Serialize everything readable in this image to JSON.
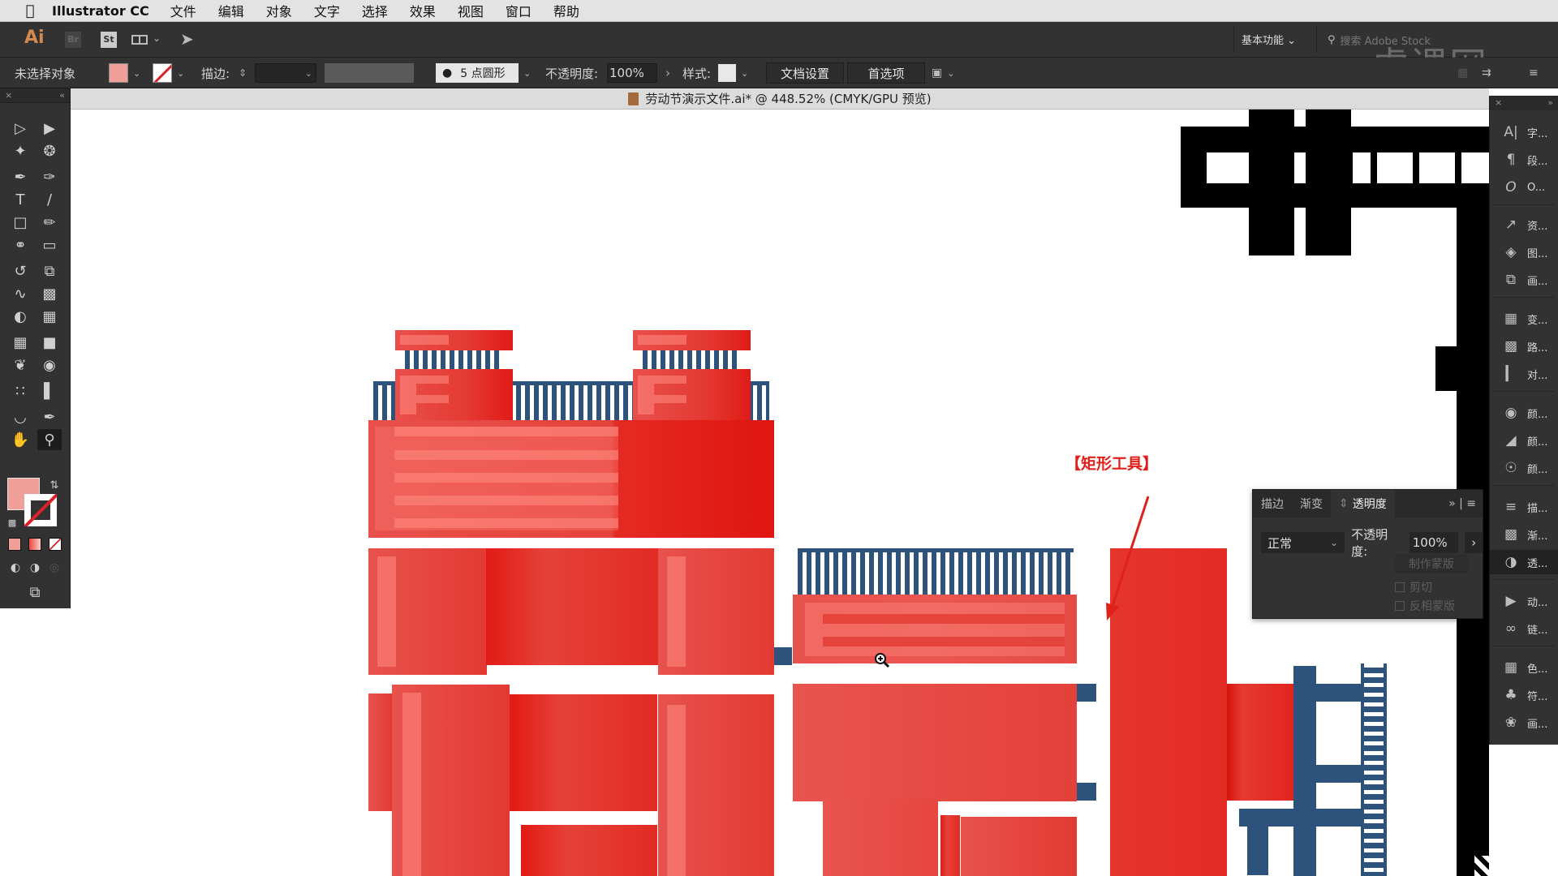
{
  "menubar": {
    "app_name": "Illustrator CC",
    "items": [
      "文件",
      "编辑",
      "对象",
      "文字",
      "选择",
      "效果",
      "视图",
      "窗口",
      "帮助"
    ]
  },
  "appbar": {
    "ai_logo": "Ai",
    "br_logo": "Br",
    "st_logo": "St",
    "workspace_label": "基本功能",
    "search_placeholder": "搜索 Adobe Stock",
    "watermark": "虎课网"
  },
  "controlbar": {
    "selection_status": "未选择对象",
    "fill_color": "#f19f99",
    "stroke_label": "描边:",
    "brush_label": "5 点圆形",
    "opacity_label": "不透明度:",
    "opacity_value": "100%",
    "style_label": "样式:",
    "doc_setup_button": "文档设置",
    "preferences_button": "首选项"
  },
  "document": {
    "title": "劳动节演示文件.ai* @ 448.52% (CMYK/GPU 预览)"
  },
  "toolbox": {
    "fill_color": "#f19f99",
    "stroke_color": "none"
  },
  "canvas": {
    "annotation": "【矩形工具】",
    "colors": {
      "red": "#e43a33",
      "navy": "#2d537c",
      "black": "#000000",
      "annotation": "#e0211b"
    }
  },
  "right_panel": {
    "items": [
      {
        "icon": "character-icon",
        "label": "字..."
      },
      {
        "icon": "paragraph-icon",
        "label": "段..."
      },
      {
        "icon": "opentype-icon",
        "label": "O..."
      },
      {
        "icon": "asset-export-icon",
        "label": "资..."
      },
      {
        "icon": "layers-icon",
        "label": "图..."
      },
      {
        "icon": "artboards-icon",
        "label": "画..."
      },
      {
        "icon": "transform-icon",
        "label": "变..."
      },
      {
        "icon": "pathfinder-icon",
        "label": "路..."
      },
      {
        "icon": "align-icon",
        "label": "对..."
      },
      {
        "icon": "color-icon",
        "label": "颜..."
      },
      {
        "icon": "color-guide-icon",
        "label": "颜..."
      },
      {
        "icon": "color-themes-icon",
        "label": "颜..."
      },
      {
        "icon": "stroke-icon",
        "label": "描..."
      },
      {
        "icon": "gradient-icon",
        "label": "渐..."
      },
      {
        "icon": "transparency-icon",
        "label": "透..."
      },
      {
        "icon": "actions-icon",
        "label": "动..."
      },
      {
        "icon": "links-icon",
        "label": "链..."
      },
      {
        "icon": "swatches-icon",
        "label": "色..."
      },
      {
        "icon": "symbols-icon",
        "label": "符..."
      },
      {
        "icon": "brushes-icon",
        "label": "画..."
      }
    ]
  },
  "transparency_panel": {
    "tabs": [
      "描边",
      "渐变",
      "透明度"
    ],
    "active_tab": "透明度",
    "blend_mode": "正常",
    "opacity_label": "不透明度:",
    "opacity_value": "100%",
    "make_mask_button": "制作蒙版",
    "clip_label": "剪切",
    "invert_mask_label": "反相蒙版"
  }
}
